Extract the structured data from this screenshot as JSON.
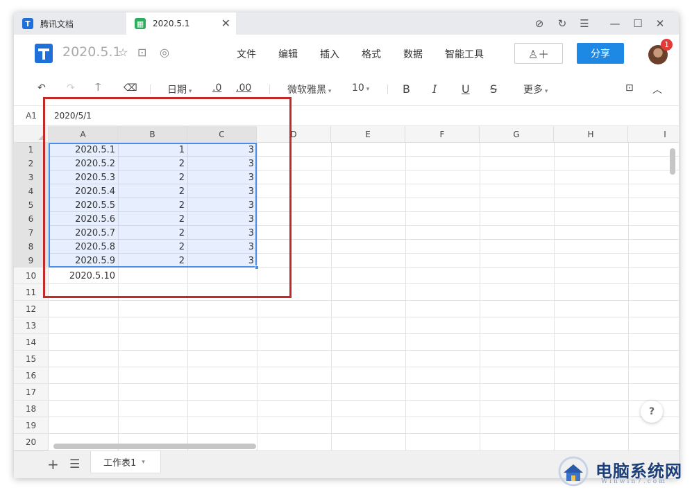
{
  "tabs": [
    {
      "label": "腾讯文档",
      "active": false
    },
    {
      "label": "2020.5.1",
      "active": true
    }
  ],
  "header": {
    "doc_title": "2020.5.1",
    "menu": [
      "文件",
      "编辑",
      "插入",
      "格式",
      "数据",
      "智能工具"
    ],
    "share_label": "分享",
    "notification_count": "1"
  },
  "toolbar": {
    "date_label": "日期",
    "dec_decrease": ".0",
    "dec_increase": ".00",
    "font_family": "微软雅黑",
    "font_size": "10",
    "bold": "B",
    "italic": "I",
    "underline": "U",
    "strike": "S",
    "more_label": "更多"
  },
  "formula_bar": {
    "cell_ref": "A1",
    "value": "2020/5/1"
  },
  "grid": {
    "columns": [
      "A",
      "B",
      "C",
      "D",
      "E",
      "F",
      "G",
      "H",
      "I"
    ],
    "rows": [
      "1",
      "2",
      "3",
      "4",
      "5",
      "6",
      "7",
      "8",
      "9",
      "10",
      "11",
      "12",
      "13",
      "14",
      "15",
      "16",
      "17",
      "18",
      "19",
      "20"
    ],
    "data": [
      [
        "2020.5.1",
        "1",
        "3"
      ],
      [
        "2020.5.2",
        "2",
        "3"
      ],
      [
        "2020.5.3",
        "2",
        "3"
      ],
      [
        "2020.5.4",
        "2",
        "3"
      ],
      [
        "2020.5.5",
        "2",
        "3"
      ],
      [
        "2020.5.6",
        "2",
        "3"
      ],
      [
        "2020.5.7",
        "2",
        "3"
      ],
      [
        "2020.5.8",
        "2",
        "3"
      ],
      [
        "2020.5.9",
        "2",
        "3"
      ],
      [
        "2020.5.10",
        "",
        ""
      ]
    ]
  },
  "sheet": {
    "active_sheet": "工作表1"
  },
  "help_label": "?",
  "watermark": {
    "text": "电脑系统网",
    "sub": "Winwin7.com"
  },
  "colors": {
    "share_button": "#1e88e5",
    "selection": "#4a8fe7",
    "highlight_box": "#c62828",
    "badge": "#e53935"
  }
}
